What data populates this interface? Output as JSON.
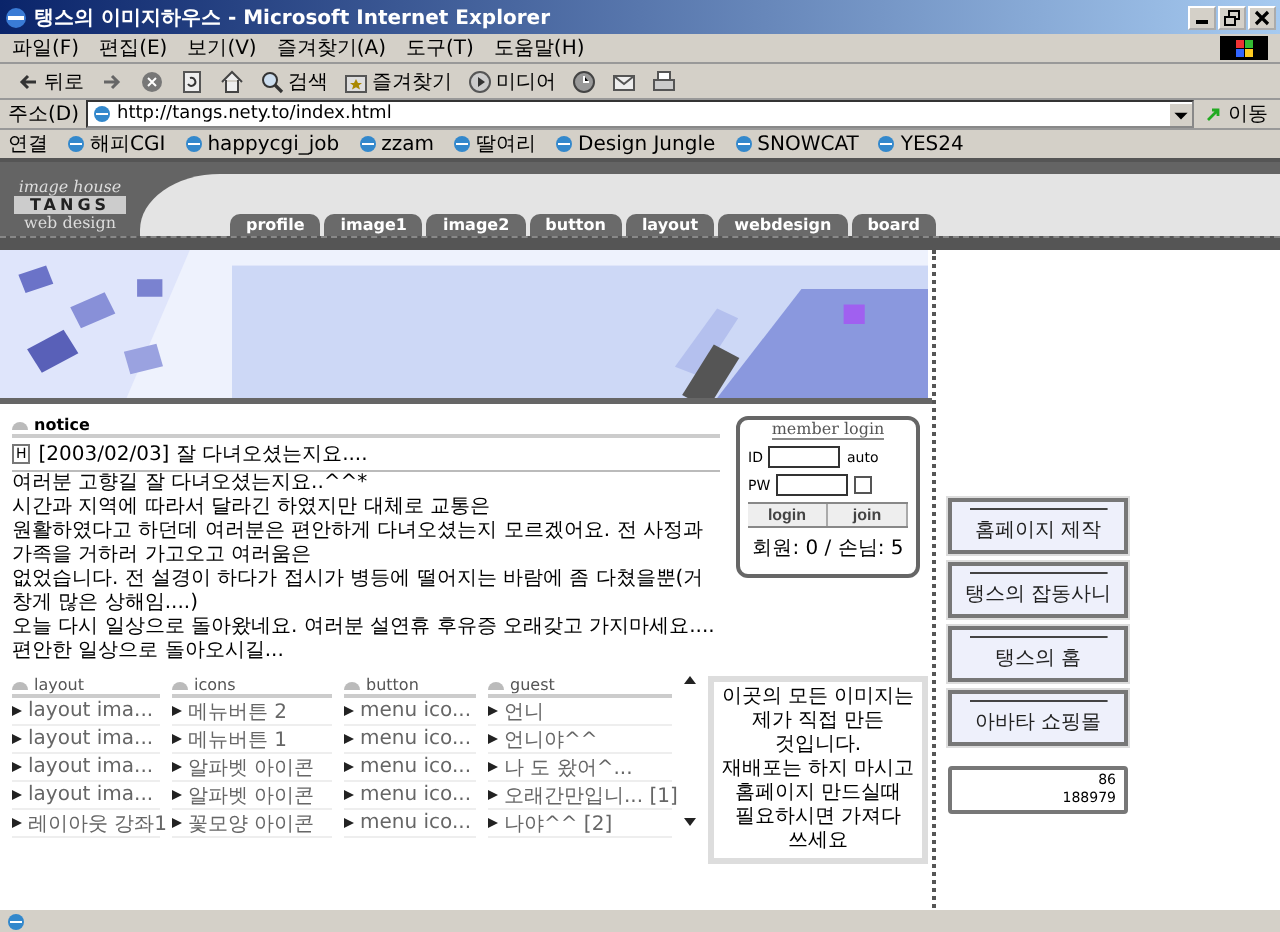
{
  "window": {
    "title": "탱스의 이미지하우스 - Microsoft Internet Explorer"
  },
  "menu_bar": [
    "파일(F)",
    "편집(E)",
    "보기(V)",
    "즐겨찾기(A)",
    "도구(T)",
    "도움말(H)"
  ],
  "toolbar": [
    {
      "kind": "back",
      "label": "뒤로"
    },
    {
      "kind": "forward"
    },
    {
      "kind": "stop"
    },
    {
      "kind": "refresh"
    },
    {
      "kind": "home"
    },
    {
      "kind": "search",
      "label": "검색"
    },
    {
      "kind": "favorites",
      "label": "즐겨찾기"
    },
    {
      "kind": "media",
      "label": "미디어"
    },
    {
      "kind": "history"
    },
    {
      "kind": "mail"
    },
    {
      "kind": "print"
    }
  ],
  "address_bar": {
    "label": "주소(D)",
    "url": "http://tangs.nety.to/index.html",
    "go": "이동"
  },
  "links_bar": {
    "label": "연결",
    "links": [
      "해피CGI",
      "happycgi_job",
      "zzam",
      "딸여리",
      "Design Jungle",
      "SNOWCAT",
      "YES24"
    ]
  },
  "site": {
    "logo": {
      "top": "image house",
      "middle": "TANGS",
      "bottom": "web design"
    },
    "tabs": [
      "profile",
      "image1",
      "image2",
      "button",
      "layout",
      "webdesign",
      "board"
    ],
    "notice": {
      "heading": "notice",
      "badge": "H",
      "subject": "[2003/02/03]  잘 다녀오셨는지요....",
      "body": [
        "여러분 고향길 잘 다녀오셨는지요..^^*",
        "시간과 지역에 따라서 달라긴 하였지만 대체로 교통은",
        "원활하였다고 하던데 여러분은 편안하게 다녀오셨는지 모르겠어요. 전 사정과 가족을 거하러 가고오고 여러움은",
        "없었습니다. 전 설경이 하다가 접시가 병등에 떨어지는 바람에 좀 다쳤을뿐(거창게 많은 상해임....)",
        "오늘 다시 일상으로 돌아왔네요. 여러분 설연휴 후유증 오래갖고 가지마세요....편안한 일상으로 돌아오시길..."
      ]
    },
    "login": {
      "title": "member login",
      "id_label": "ID",
      "auto_label": "auto",
      "pw_label": "PW",
      "auto_checked": false,
      "login_button": "login",
      "join_button": "join",
      "stats": "회원: 0 / 손님: 5"
    },
    "lists": [
      {
        "title": "layout",
        "items": [
          "layout ima...",
          "layout ima...",
          "layout ima...",
          "layout ima...",
          "레이아웃 강좌1"
        ]
      },
      {
        "title": "icons",
        "items": [
          "메뉴버튼 2",
          "메뉴버튼 1",
          "알파벳 아이콘",
          "알파벳 아이콘",
          "꽃모양 아이콘"
        ]
      },
      {
        "title": "button",
        "items": [
          "menu ico...",
          "menu ico...",
          "menu ico...",
          "menu ico...",
          "menu ico..."
        ]
      },
      {
        "title": "guest",
        "items": [
          "언니",
          "언니야^^",
          "나 도 왔어^...",
          "오래간만입니... [1]",
          "나야^^ [2]"
        ]
      }
    ],
    "info_box": [
      "이곳의 모든 이미지는",
      "제가 직접 만든",
      "것입니다.",
      "재배포는 하지 마시고",
      "홈페이지 만드실때",
      "필요하시면 가져다",
      "쓰세요"
    ],
    "side_buttons": [
      "홈페이지 제작",
      "탱스의 잡동사니",
      "탱스의 홈",
      "아바타 쇼핑몰"
    ],
    "counter": {
      "today": "86",
      "total": "188979"
    }
  }
}
